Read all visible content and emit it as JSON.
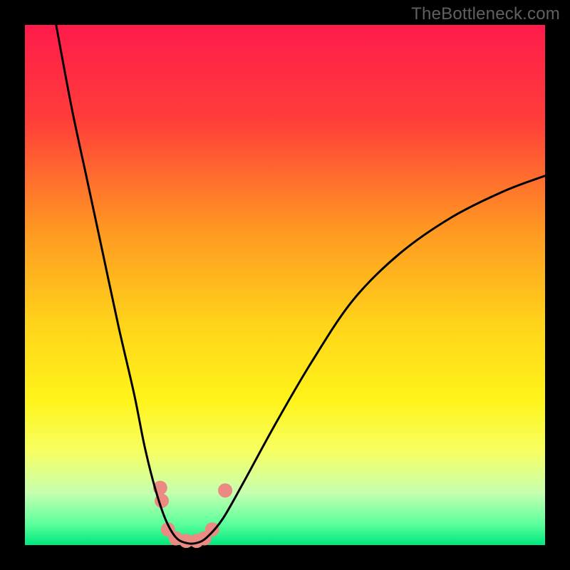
{
  "watermark": "TheBottleneck.com",
  "chart_data": {
    "type": "line",
    "title": "",
    "xlabel": "",
    "ylabel": "",
    "xlim": [
      0,
      100
    ],
    "ylim": [
      0,
      100
    ],
    "background_gradient": {
      "stops": [
        {
          "offset": 0.0,
          "color": "#ff1b4b"
        },
        {
          "offset": 0.18,
          "color": "#ff3d3a"
        },
        {
          "offset": 0.4,
          "color": "#ff9a22"
        },
        {
          "offset": 0.58,
          "color": "#ffd51a"
        },
        {
          "offset": 0.72,
          "color": "#fff31a"
        },
        {
          "offset": 0.82,
          "color": "#f7ff63"
        },
        {
          "offset": 0.9,
          "color": "#c6ffb0"
        },
        {
          "offset": 0.96,
          "color": "#5aff9c"
        },
        {
          "offset": 1.0,
          "color": "#00e77d"
        }
      ]
    },
    "series": [
      {
        "name": "bottleneck-curve",
        "color": "#000000",
        "points": [
          {
            "x": 6.0,
            "y": 100.0
          },
          {
            "x": 9.0,
            "y": 84.0
          },
          {
            "x": 12.0,
            "y": 70.0
          },
          {
            "x": 15.0,
            "y": 56.0
          },
          {
            "x": 18.0,
            "y": 42.0
          },
          {
            "x": 21.0,
            "y": 29.0
          },
          {
            "x": 23.0,
            "y": 19.0
          },
          {
            "x": 25.0,
            "y": 11.0
          },
          {
            "x": 27.0,
            "y": 5.0
          },
          {
            "x": 29.0,
            "y": 1.5
          },
          {
            "x": 31.0,
            "y": 0.4
          },
          {
            "x": 33.0,
            "y": 0.4
          },
          {
            "x": 35.0,
            "y": 1.5
          },
          {
            "x": 38.0,
            "y": 5.0
          },
          {
            "x": 42.0,
            "y": 12.0
          },
          {
            "x": 48.0,
            "y": 23.0
          },
          {
            "x": 55.0,
            "y": 35.0
          },
          {
            "x": 63.0,
            "y": 47.0
          },
          {
            "x": 72.0,
            "y": 56.0
          },
          {
            "x": 82.0,
            "y": 63.0
          },
          {
            "x": 92.0,
            "y": 68.0
          },
          {
            "x": 100.0,
            "y": 71.0
          }
        ]
      }
    ],
    "marker_points": {
      "color": "#eb8a83",
      "radius": 10,
      "coords": [
        {
          "x": 26.0,
          "y": 11.0
        },
        {
          "x": 26.3,
          "y": 8.5
        },
        {
          "x": 27.5,
          "y": 3.0
        },
        {
          "x": 29.0,
          "y": 1.3
        },
        {
          "x": 31.0,
          "y": 0.8
        },
        {
          "x": 33.0,
          "y": 0.8
        },
        {
          "x": 34.5,
          "y": 1.3
        },
        {
          "x": 36.0,
          "y": 3.0
        },
        {
          "x": 38.5,
          "y": 10.5
        }
      ]
    }
  }
}
